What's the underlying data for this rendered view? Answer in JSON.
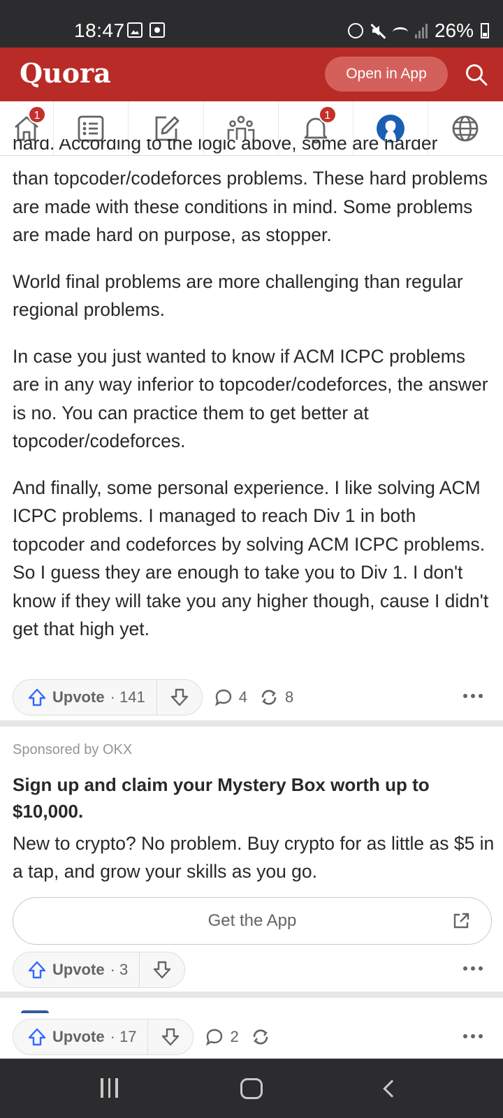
{
  "status_bar": {
    "time": "18:47",
    "battery": "26%"
  },
  "header": {
    "logo": "Quora",
    "open_in_app": "Open in App"
  },
  "nav": {
    "home_badge": "1",
    "notifications_badge": "1"
  },
  "answer": {
    "clipped_line": "hard. According to the logic above, some are harder",
    "paragraphs": [
      "than topcoder/codeforces problems. These hard problems are made with these conditions in mind. Some problems are made hard on purpose, as stopper.",
      "World final problems are more challenging than regular regional problems.",
      "In case you just wanted to know if ACM ICPC problems are in any way inferior to topcoder/codeforces, the answer is no. You can practice them to get better at topcoder/codeforces.",
      "And finally, some personal experience. I like solving ACM ICPC problems. I managed to reach Div 1 in both topcoder and codeforces by solving ACM ICPC problems. So I guess they are enough to take you to Div 1. I don't know if they will take you any higher though, cause I didn't get that high yet."
    ],
    "upvote_label": "Upvote",
    "upvote_count": "· 141",
    "comments": "4",
    "shares": "8"
  },
  "ad": {
    "sponsored": "Sponsored by OKX",
    "title": "Sign up and claim your Mystery Box worth up to $10,000.",
    "body": "New to crypto? No problem. Buy crypto for as little as $5 in a tap, and grow your skills as you go.",
    "cta": "Get the App",
    "upvote_label": "Upvote",
    "upvote_count": "· 3"
  },
  "next_answer": {
    "upvote_label": "Upvote",
    "upvote_count": "· 17",
    "comments": "2"
  },
  "colors": {
    "brand": "#b92b27",
    "accent_blue": "#2e69ff"
  }
}
